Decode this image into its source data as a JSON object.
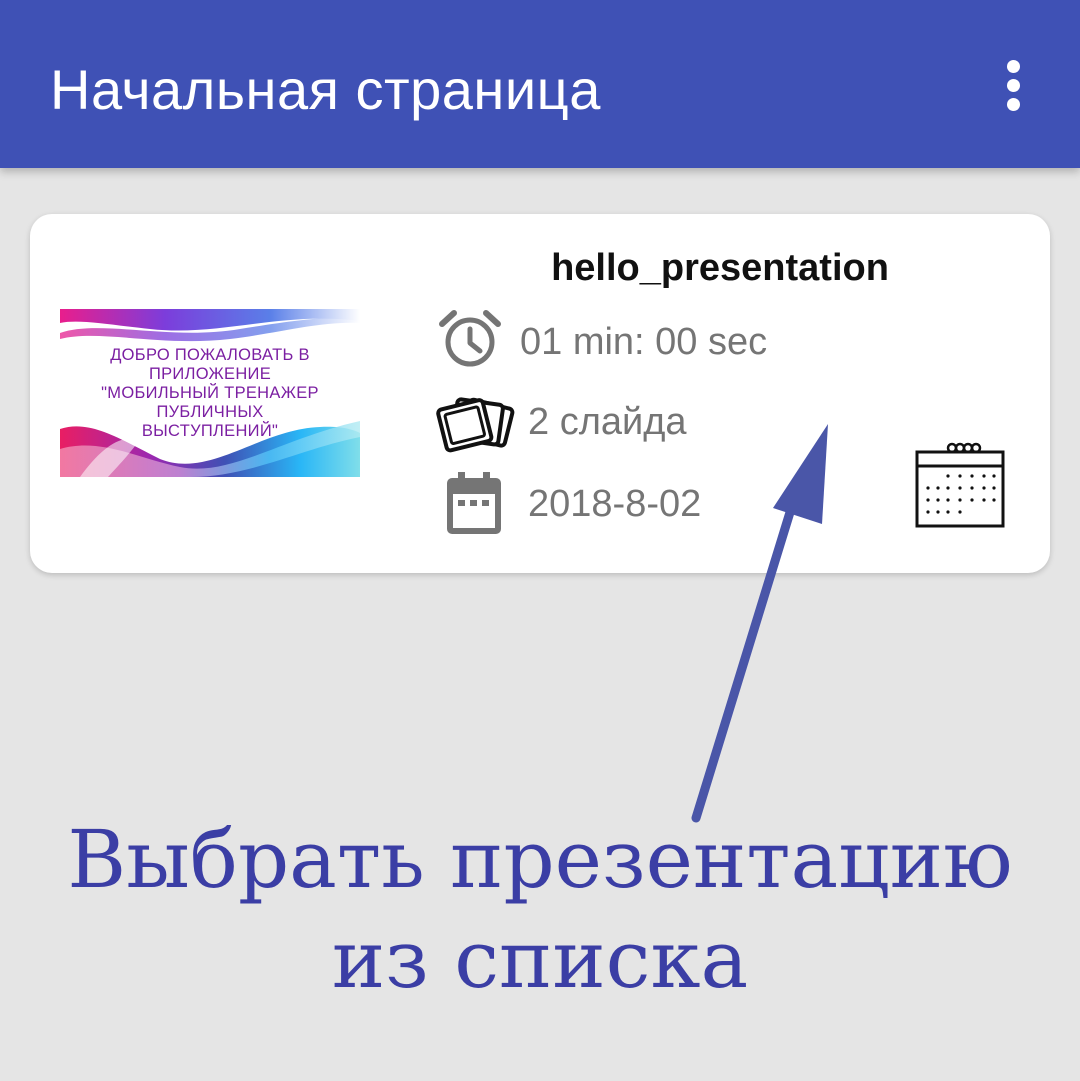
{
  "appbar": {
    "title": "Начальная страница",
    "menu_icon": "more-vert-icon",
    "color": "#3f51b5"
  },
  "presentation": {
    "title": "hello_presentation",
    "thumbnail_text": "ДОБРО ПОЖАЛОВАТЬ В ПРИЛОЖЕНИЕ \"МОБИЛЬНЫЙ ТРЕНАЖЕР ПУБЛИЧНЫХ ВЫСТУПЛЕНИЙ\"",
    "duration": "01 min: 00 sec",
    "slides": "2 слайда",
    "date": "2018-8-02",
    "icons": {
      "duration": "alarm-clock-icon",
      "slides": "slides-stack-icon",
      "date": "calendar-icon",
      "schedule": "calendar-spiral-icon"
    }
  },
  "annotation": {
    "line1": "Выбрать презентацию",
    "line2": "из списка",
    "color": "#3b3ea5"
  }
}
